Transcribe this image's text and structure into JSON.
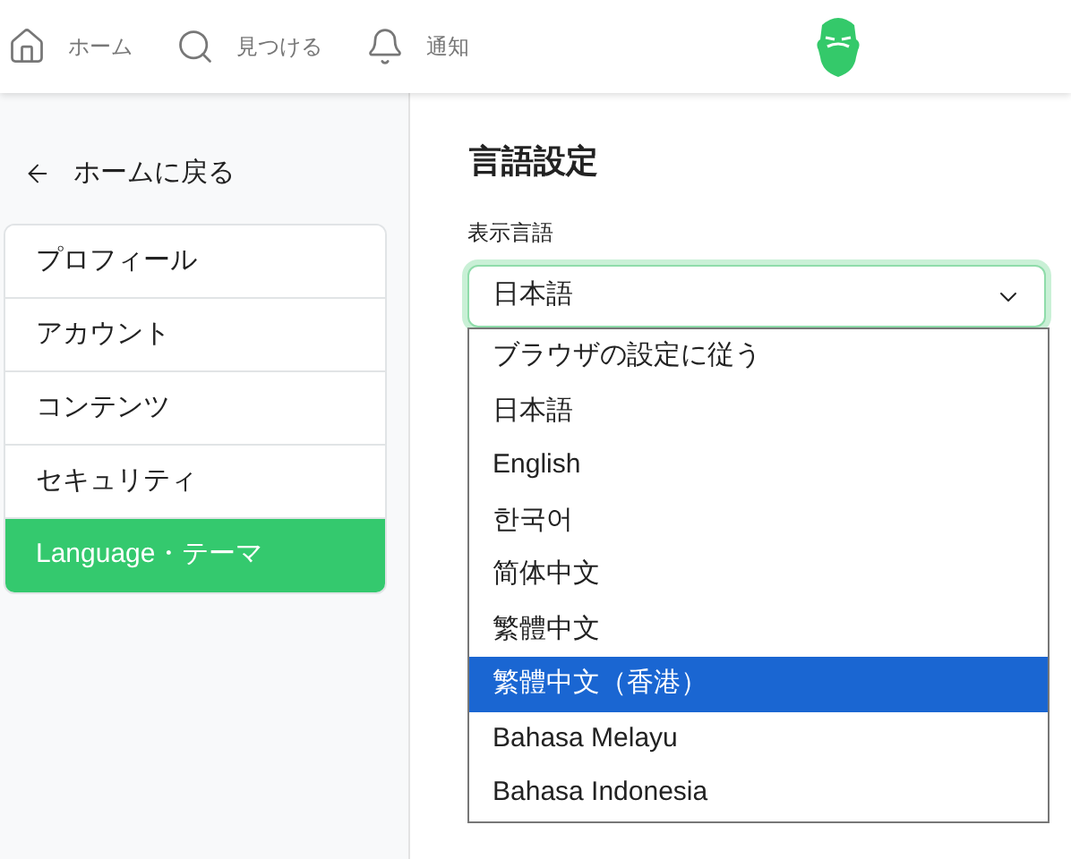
{
  "nav": [
    {
      "kind": "home",
      "label": "ホーム"
    },
    {
      "kind": "search",
      "label": "見つける"
    },
    {
      "kind": "bell",
      "label": "通知"
    }
  ],
  "sidebar": {
    "back": "ホームに戻る",
    "items": [
      {
        "label": "プロフィール",
        "selected": false
      },
      {
        "label": "アカウント",
        "selected": false
      },
      {
        "label": "コンテンツ",
        "selected": false
      },
      {
        "label": "セキュリティ",
        "selected": false
      },
      {
        "label": "Language・テーマ",
        "selected": true
      }
    ]
  },
  "main": {
    "title": "言語設定",
    "field_label": "表示言語",
    "select": {
      "value": "日本語",
      "expanded": true,
      "options": [
        {
          "label": "ブラウザの設定に従う",
          "highlighted": false
        },
        {
          "label": "日本語",
          "highlighted": false
        },
        {
          "label": "English",
          "highlighted": false
        },
        {
          "label": "한국어",
          "highlighted": false
        },
        {
          "label": "简体中文",
          "highlighted": false
        },
        {
          "label": "繁體中文",
          "highlighted": false
        },
        {
          "label": "繁體中文（香港）",
          "highlighted": true
        },
        {
          "label": "Bahasa Melayu",
          "highlighted": false
        },
        {
          "label": "Bahasa Indonesia",
          "highlighted": false
        }
      ]
    }
  }
}
